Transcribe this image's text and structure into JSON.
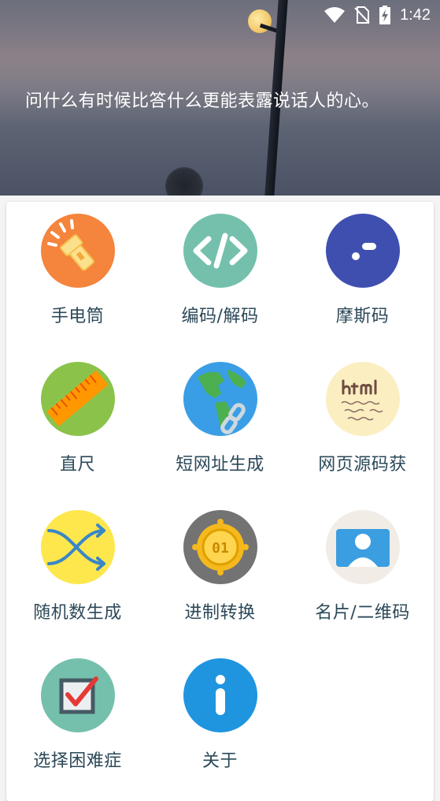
{
  "status_bar": {
    "time": "1:42",
    "icons": [
      "wifi-icon",
      "no-sim-icon",
      "battery-charging-icon"
    ]
  },
  "header": {
    "quote": "问什么有时候比答什么更能表露说话人的心。"
  },
  "tools": [
    {
      "label": "手电筒",
      "icon": "flashlight-icon",
      "color": "#f5843c"
    },
    {
      "label": "编码/解码",
      "icon": "code-icon",
      "color": "#74c0ac"
    },
    {
      "label": "摩斯码",
      "icon": "morse-icon",
      "color": "#3f4fb0"
    },
    {
      "label": "直尺",
      "icon": "ruler-icon",
      "color": "#8bc34a"
    },
    {
      "label": "短网址生成",
      "icon": "globe-link-icon",
      "color": "#3a9ee6"
    },
    {
      "label": "网页源码获",
      "icon": "html-paper-icon",
      "color": "#fbeec1"
    },
    {
      "label": "随机数生成",
      "icon": "shuffle-icon",
      "color": "#fde74c"
    },
    {
      "label": "进制转换",
      "icon": "binary-coin-icon",
      "color": "#737373"
    },
    {
      "label": "名片/二维码",
      "icon": "contact-card-icon",
      "color": "#f1ede6"
    },
    {
      "label": "选择困难症",
      "icon": "checkbox-icon",
      "color": "#74c0ac"
    },
    {
      "label": "关于",
      "icon": "info-icon",
      "color": "#1f95e0"
    }
  ]
}
